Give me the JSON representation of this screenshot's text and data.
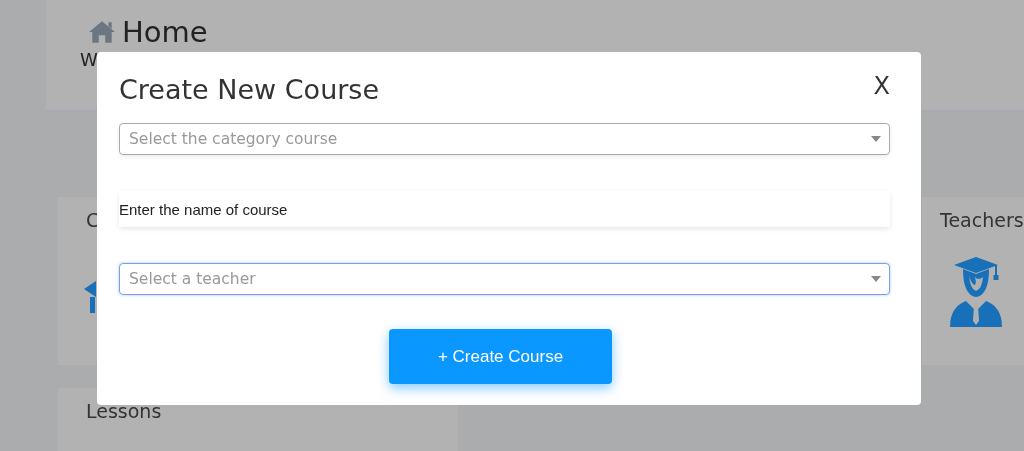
{
  "page": {
    "header": {
      "title": "Home",
      "subtitle": "W"
    },
    "cards": [
      {
        "title": "C",
        "kind": "course"
      },
      {
        "title": "Teachers",
        "kind": "teacher"
      },
      {
        "title": "Lessons",
        "kind": "plain"
      }
    ]
  },
  "modal": {
    "title": "Create New Course",
    "close": "X",
    "fields": [
      {
        "kind": "select",
        "placeholder": "Select the category course",
        "focused": false
      },
      {
        "kind": "text",
        "placeholder": "Enter the name of course",
        "focused": false
      },
      {
        "kind": "select",
        "placeholder": "Select a teacher",
        "focused": true
      }
    ],
    "submit": "+ Create Course"
  }
}
